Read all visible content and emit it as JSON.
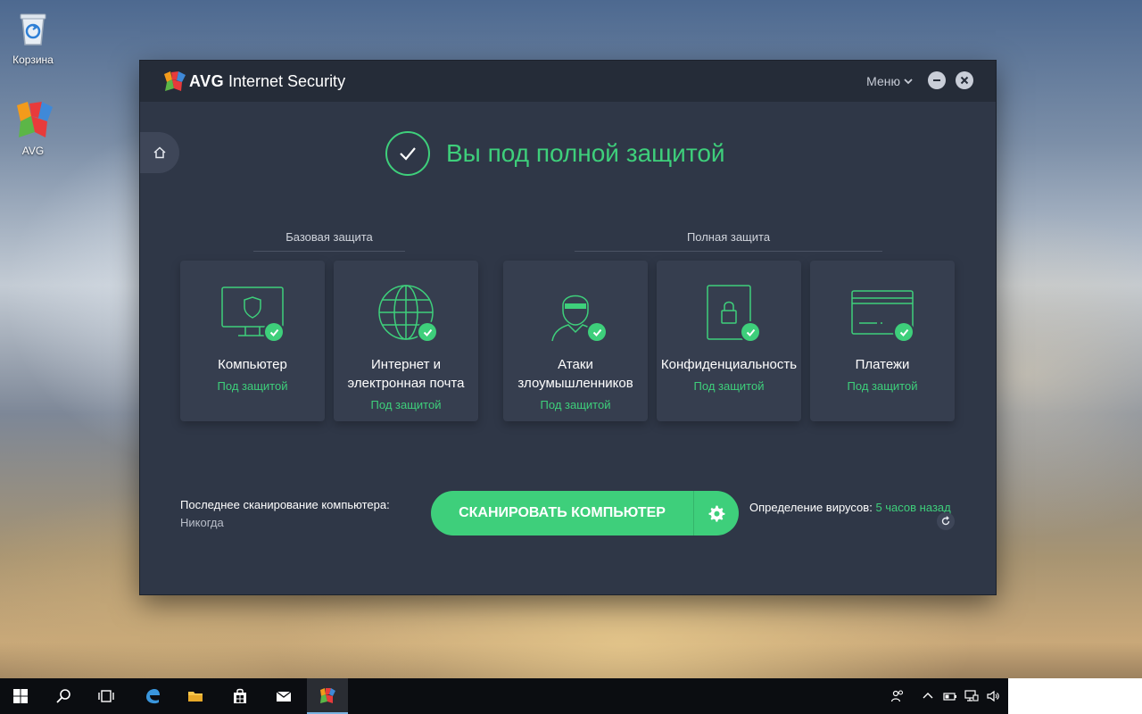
{
  "desktop": {
    "icons": [
      {
        "label": "Корзина",
        "icon": "recycle-bin-icon"
      },
      {
        "label": "AVG",
        "icon": "avg-logo-icon"
      }
    ]
  },
  "window": {
    "brand": "AVG",
    "product": "Internet Security",
    "menu_label": "Меню",
    "controls": [
      "minimize-icon",
      "close-icon"
    ]
  },
  "status": {
    "text": "Вы под полной защитой",
    "icon": "check-icon",
    "color": "#3ecf7b"
  },
  "groups": {
    "basic": "Базовая защита",
    "full": "Полная защита"
  },
  "cards": [
    {
      "title_lines": [
        "Компьютер"
      ],
      "status": "Под защитой",
      "icon": "monitor-shield-icon"
    },
    {
      "title_lines": [
        "Интернет и",
        "электронная почта"
      ],
      "status": "Под защитой",
      "icon": "globe-icon"
    },
    {
      "title_lines": [
        "Атаки",
        "злоумышленников"
      ],
      "status": "Под защитой",
      "icon": "hacker-icon"
    },
    {
      "title_lines": [
        "Конфиденциальность"
      ],
      "status": "Под защитой",
      "icon": "lock-icon"
    },
    {
      "title_lines": [
        "Платежи"
      ],
      "status": "Под защитой",
      "icon": "credit-card-icon"
    }
  ],
  "scan": {
    "last_scan_label": "Последнее сканирование компьютера:",
    "last_scan_value": "Никогда",
    "button_label": "СКАНИРОВАТЬ КОМПЬЮТЕР",
    "settings_icon": "gear-icon"
  },
  "virus_definitions": {
    "label": "Определение вирусов:",
    "time": "5 часов назад",
    "refresh_icon": "refresh-icon"
  },
  "colors": {
    "accent": "#3ecf7b",
    "window_bg": "#2f3747",
    "titlebar_bg": "#252c38",
    "card_bg": "#363e4f"
  },
  "taskbar": {
    "items": [
      "windows-start-icon",
      "search-icon",
      "task-view-icon",
      "edge-icon",
      "file-explorer-icon",
      "store-icon",
      "mail-icon",
      "avg-taskbar-icon"
    ],
    "tray": [
      "people-icon",
      "chevron-up-icon",
      "battery-icon",
      "network-icon",
      "volume-icon"
    ]
  }
}
